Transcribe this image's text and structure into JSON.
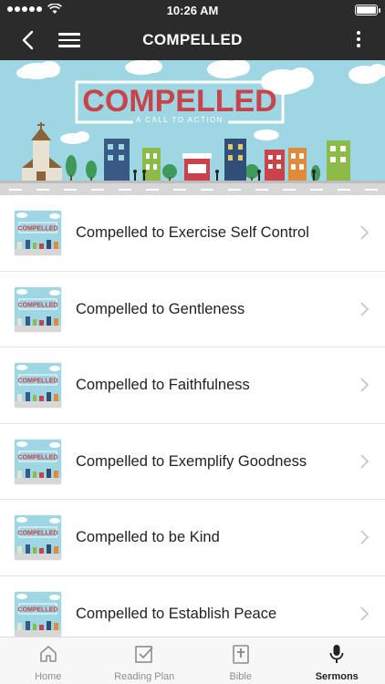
{
  "status_bar": {
    "time": "10:26 AM"
  },
  "nav": {
    "title": "COMPELLED"
  },
  "banner": {
    "title": "COMPELLED",
    "subtitle": "A CALL TO ACTION"
  },
  "thumbnail_text": "COMPELLED",
  "sermons": [
    {
      "title": "Compelled to Exercise Self Control"
    },
    {
      "title": "Compelled to Gentleness"
    },
    {
      "title": "Compelled to Faithfulness"
    },
    {
      "title": "Compelled to Exemplify Goodness"
    },
    {
      "title": "Compelled to be Kind"
    },
    {
      "title": "Compelled to Establish Peace"
    }
  ],
  "tabs": [
    {
      "label": "Home",
      "icon": "home-icon",
      "active": false
    },
    {
      "label": "Reading Plan",
      "icon": "checkbox-icon",
      "active": false
    },
    {
      "label": "Bible",
      "icon": "bible-icon",
      "active": false
    },
    {
      "label": "Sermons",
      "icon": "microphone-icon",
      "active": true
    }
  ],
  "colors": {
    "bar": "#2b2b2b",
    "sky": "#9ed6e3",
    "brand_red": "#c8434a",
    "active_tab": "#222222",
    "inactive_tab": "#8e8e8e"
  }
}
